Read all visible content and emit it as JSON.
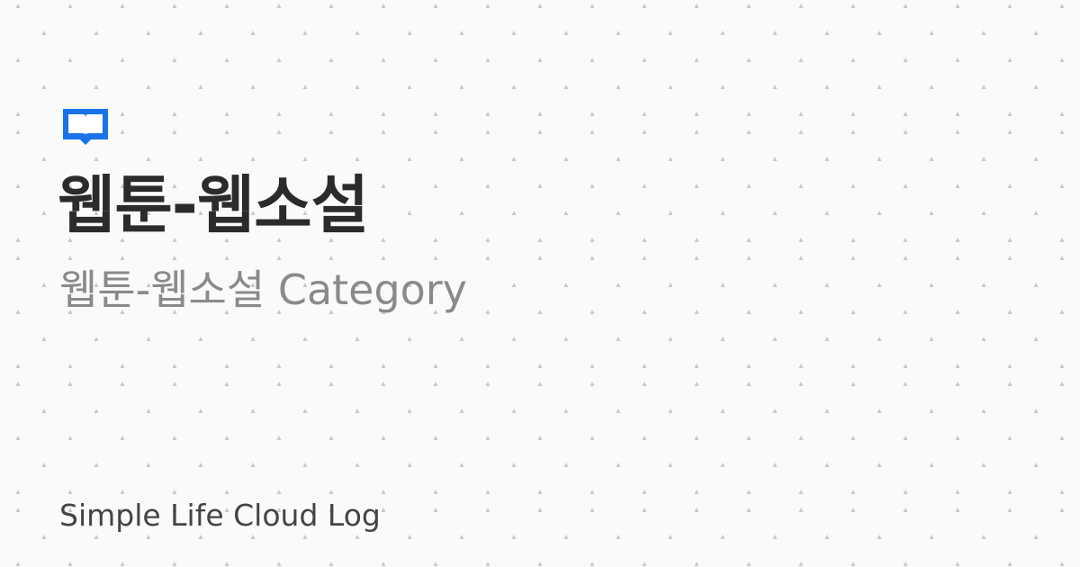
{
  "card": {
    "title": "웹툰-웹소설",
    "subtitle": "웹툰-웹소설 Category",
    "blog_name": "Simple Life Cloud Log",
    "icon": "book-icon",
    "accent_color": "#1a73e8"
  }
}
